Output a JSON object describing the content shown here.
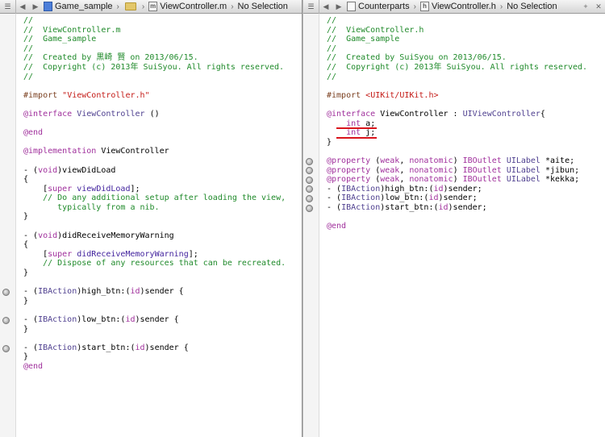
{
  "left": {
    "jumpbar": {
      "project": "Game_sample",
      "file": "ViewController.m",
      "selection": "No Selection"
    },
    "lines": [
      [
        {
          "c": "com",
          "t": "//"
        }
      ],
      [
        {
          "c": "com",
          "t": "//  ViewController.m"
        }
      ],
      [
        {
          "c": "com",
          "t": "//  Game_sample"
        }
      ],
      [
        {
          "c": "com",
          "t": "//"
        }
      ],
      [
        {
          "c": "com",
          "t": "//  Created by 黒崎 賢 on 2013/06/15."
        }
      ],
      [
        {
          "c": "com",
          "t": "//  Copyright (c) 2013年 SuiSyou. All rights reserved."
        }
      ],
      [
        {
          "c": "com",
          "t": "//"
        }
      ],
      [],
      [
        {
          "c": "pre",
          "t": "#import "
        },
        {
          "c": "str",
          "t": "\"ViewController.h\""
        }
      ],
      [],
      [
        {
          "c": "kw",
          "t": "@interface"
        },
        {
          "c": "",
          "t": " "
        },
        {
          "c": "cls",
          "t": "ViewController"
        },
        {
          "c": "",
          "t": " ()"
        }
      ],
      [],
      [
        {
          "c": "kw",
          "t": "@end"
        }
      ],
      [],
      [
        {
          "c": "kw",
          "t": "@implementation"
        },
        {
          "c": "",
          "t": " ViewController"
        }
      ],
      [],
      [
        {
          "c": "",
          "t": "- ("
        },
        {
          "c": "kw",
          "t": "void"
        },
        {
          "c": "",
          "t": ")viewDidLoad"
        }
      ],
      [
        {
          "c": "",
          "t": "{"
        }
      ],
      [
        {
          "c": "",
          "t": "    ["
        },
        {
          "c": "kw",
          "t": "super"
        },
        {
          "c": "",
          "t": " "
        },
        {
          "c": "meth",
          "t": "viewDidLoad"
        },
        {
          "c": "",
          "t": "];"
        }
      ],
      [
        {
          "c": "com",
          "t": "    // Do any additional setup after loading the view,"
        }
      ],
      [
        {
          "c": "com",
          "t": "       typically from a nib."
        }
      ],
      [
        {
          "c": "",
          "t": "}"
        }
      ],
      [],
      [
        {
          "c": "",
          "t": "- ("
        },
        {
          "c": "kw",
          "t": "void"
        },
        {
          "c": "",
          "t": ")didReceiveMemoryWarning"
        }
      ],
      [
        {
          "c": "",
          "t": "{"
        }
      ],
      [
        {
          "c": "",
          "t": "    ["
        },
        {
          "c": "kw",
          "t": "super"
        },
        {
          "c": "",
          "t": " "
        },
        {
          "c": "meth",
          "t": "didReceiveMemoryWarning"
        },
        {
          "c": "",
          "t": "];"
        }
      ],
      [
        {
          "c": "com",
          "t": "    // Dispose of any resources that can be recreated."
        }
      ],
      [
        {
          "c": "",
          "t": "}"
        }
      ],
      [],
      [
        {
          "c": "",
          "t": "- ("
        },
        {
          "c": "cls",
          "t": "IBAction"
        },
        {
          "c": "",
          "t": ")high_btn:("
        },
        {
          "c": "kw",
          "t": "id"
        },
        {
          "c": "",
          "t": ")sender {"
        }
      ],
      [
        {
          "c": "",
          "t": "}"
        }
      ],
      [],
      [
        {
          "c": "",
          "t": "- ("
        },
        {
          "c": "cls",
          "t": "IBAction"
        },
        {
          "c": "",
          "t": ")low_btn:("
        },
        {
          "c": "kw",
          "t": "id"
        },
        {
          "c": "",
          "t": ")sender {"
        }
      ],
      [
        {
          "c": "",
          "t": "}"
        }
      ],
      [],
      [
        {
          "c": "",
          "t": "- ("
        },
        {
          "c": "cls",
          "t": "IBAction"
        },
        {
          "c": "",
          "t": ")start_btn:("
        },
        {
          "c": "kw",
          "t": "id"
        },
        {
          "c": "",
          "t": ")sender {"
        }
      ],
      [
        {
          "c": "",
          "t": "}"
        }
      ],
      [
        {
          "c": "kw",
          "t": "@end"
        }
      ]
    ]
  },
  "right": {
    "jumpbar": {
      "group": "Counterparts",
      "file": "ViewController.h",
      "selection": "No Selection"
    },
    "lines": [
      [
        {
          "c": "com",
          "t": "//"
        }
      ],
      [
        {
          "c": "com",
          "t": "//  ViewController.h"
        }
      ],
      [
        {
          "c": "com",
          "t": "//  Game_sample"
        }
      ],
      [
        {
          "c": "com",
          "t": "//"
        }
      ],
      [
        {
          "c": "com",
          "t": "//  Created by SuiSyou on 2013/06/15."
        }
      ],
      [
        {
          "c": "com",
          "t": "//  Copyright (c) 2013年 SuiSyou. All rights reserved."
        }
      ],
      [
        {
          "c": "com",
          "t": "//"
        }
      ],
      [],
      [
        {
          "c": "pre",
          "t": "#import "
        },
        {
          "c": "str",
          "t": "<UIKit/UIKit.h>"
        }
      ],
      [],
      [
        {
          "c": "kw",
          "t": "@interface"
        },
        {
          "c": "",
          "t": " ViewController : "
        },
        {
          "c": "cls",
          "t": "UIViewController"
        },
        {
          "c": "",
          "t": "{"
        }
      ],
      [
        {
          "c": "",
          "t": "    "
        },
        {
          "c": "kw",
          "t": "int"
        },
        {
          "c": "",
          "t": " a;"
        }
      ],
      [
        {
          "c": "",
          "t": "    "
        },
        {
          "c": "kw",
          "t": "int"
        },
        {
          "c": "",
          "t": " j;"
        }
      ],
      [
        {
          "c": "",
          "t": "}"
        }
      ],
      [],
      [
        {
          "c": "kw",
          "t": "@property"
        },
        {
          "c": "",
          "t": " ("
        },
        {
          "c": "kw",
          "t": "weak"
        },
        {
          "c": "",
          "t": ", "
        },
        {
          "c": "kw",
          "t": "nonatomic"
        },
        {
          "c": "",
          "t": ") "
        },
        {
          "c": "kw",
          "t": "IBOutlet"
        },
        {
          "c": "",
          "t": " "
        },
        {
          "c": "cls",
          "t": "UILabel"
        },
        {
          "c": "",
          "t": " *aite;"
        }
      ],
      [
        {
          "c": "kw",
          "t": "@property"
        },
        {
          "c": "",
          "t": " ("
        },
        {
          "c": "kw",
          "t": "weak"
        },
        {
          "c": "",
          "t": ", "
        },
        {
          "c": "kw",
          "t": "nonatomic"
        },
        {
          "c": "",
          "t": ") "
        },
        {
          "c": "kw",
          "t": "IBOutlet"
        },
        {
          "c": "",
          "t": " "
        },
        {
          "c": "cls",
          "t": "UILabel"
        },
        {
          "c": "",
          "t": " *jibun;"
        }
      ],
      [
        {
          "c": "kw",
          "t": "@property"
        },
        {
          "c": "",
          "t": " ("
        },
        {
          "c": "kw",
          "t": "weak"
        },
        {
          "c": "",
          "t": ", "
        },
        {
          "c": "kw",
          "t": "nonatomic"
        },
        {
          "c": "",
          "t": ") "
        },
        {
          "c": "kw",
          "t": "IBOutlet"
        },
        {
          "c": "",
          "t": " "
        },
        {
          "c": "cls",
          "t": "UILabel"
        },
        {
          "c": "",
          "t": " *kekka;"
        }
      ],
      [
        {
          "c": "",
          "t": "- ("
        },
        {
          "c": "cls",
          "t": "IBAction"
        },
        {
          "c": "",
          "t": ")high_btn:("
        },
        {
          "c": "kw",
          "t": "id"
        },
        {
          "c": "",
          "t": ")sender;"
        }
      ],
      [
        {
          "c": "",
          "t": "- ("
        },
        {
          "c": "cls",
          "t": "IBAction"
        },
        {
          "c": "",
          "t": ")low_btn:("
        },
        {
          "c": "kw",
          "t": "id"
        },
        {
          "c": "",
          "t": ")sender;"
        }
      ],
      [
        {
          "c": "",
          "t": "- ("
        },
        {
          "c": "cls",
          "t": "IBAction"
        },
        {
          "c": "",
          "t": ")start_btn:("
        },
        {
          "c": "kw",
          "t": "id"
        },
        {
          "c": "",
          "t": ")sender;"
        }
      ],
      [],
      [
        {
          "c": "kw",
          "t": "@end"
        }
      ]
    ]
  },
  "colors": {
    "comment": "#1f8a2a",
    "keyword": "#a0309c",
    "string": "#c41a16",
    "preprocessor": "#7a3f1f",
    "class": "#4e3f8f",
    "annotation_underline": "#d9141c"
  }
}
